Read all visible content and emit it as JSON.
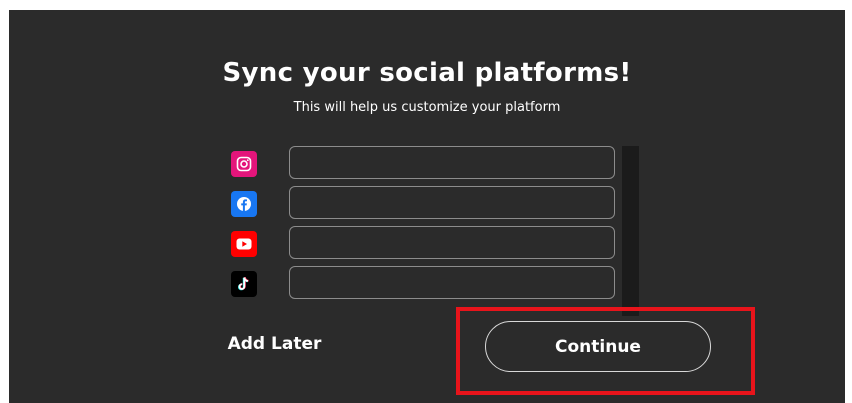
{
  "header": {
    "title": "Sync your social platforms!",
    "subtitle": "This will help us customize your platform"
  },
  "social_inputs": [
    {
      "platform": "Instagram",
      "icon": "instagram-icon",
      "color": "#e4157b",
      "value": "",
      "placeholder": ""
    },
    {
      "platform": "Facebook",
      "icon": "facebook-icon",
      "color": "#1877f2",
      "value": "",
      "placeholder": ""
    },
    {
      "platform": "YouTube",
      "icon": "youtube-icon",
      "color": "#ff0000",
      "value": "",
      "placeholder": ""
    },
    {
      "platform": "TikTok",
      "icon": "tiktok-icon",
      "color": "#000000",
      "value": "",
      "placeholder": ""
    }
  ],
  "actions": {
    "add_later_label": "Add Later",
    "continue_label": "Continue"
  },
  "colors": {
    "background": "#2b2b2b",
    "highlight": "#e8141b"
  }
}
